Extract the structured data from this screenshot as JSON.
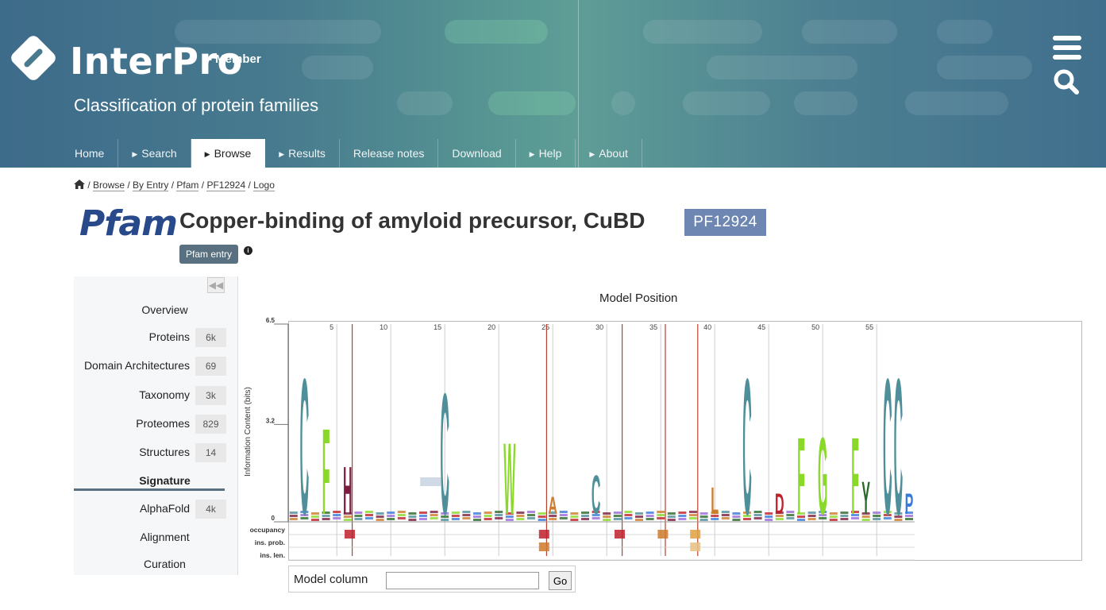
{
  "header": {
    "app_name": "InterPro",
    "app_suffix": "- Member",
    "tagline": "Classification of protein families"
  },
  "nav": [
    {
      "label": "Home",
      "arrow": false
    },
    {
      "label": "Search",
      "arrow": true
    },
    {
      "label": "Browse",
      "arrow": true,
      "active": true
    },
    {
      "label": "Results",
      "arrow": true
    },
    {
      "label": "Release notes",
      "arrow": false
    },
    {
      "label": "Download",
      "arrow": false
    },
    {
      "label": "Help",
      "arrow": true
    },
    {
      "label": "About",
      "arrow": true
    }
  ],
  "breadcrumb": [
    "Browse",
    "By Entry",
    "Pfam",
    "PF12924",
    "Logo"
  ],
  "entry": {
    "db_logo": "Pfam",
    "title": "Copper-binding of amyloid precursor, CuBD",
    "accession": "PF12924",
    "type_badge": "Pfam entry"
  },
  "side_menu": [
    {
      "label": "Overview",
      "count": ""
    },
    {
      "label": "Proteins",
      "count": "6k"
    },
    {
      "label": "Domain Architectures",
      "count": "69"
    },
    {
      "label": "Taxonomy",
      "count": "3k"
    },
    {
      "label": "Proteomes",
      "count": "829"
    },
    {
      "label": "Structures",
      "count": "14"
    },
    {
      "label": "Signature",
      "count": "",
      "active": true
    },
    {
      "label": "AlphaFold",
      "count": "4k"
    },
    {
      "label": "Alignment",
      "count": ""
    },
    {
      "label": "Curation",
      "count": ""
    }
  ],
  "hmm_logo": {
    "title": "Model Position",
    "y_axis_label": "Information Content (bits)",
    "y_ticks": [
      "6.5",
      "3.2",
      "0"
    ],
    "row_labels": [
      "occupancy",
      "ins. prob.",
      "ins. len."
    ],
    "x_ticks": [
      "5",
      "10",
      "15",
      "20",
      "25",
      "30",
      "35",
      "40",
      "45",
      "50",
      "55"
    ],
    "letters": [
      {
        "pos": 2,
        "aa": "C",
        "color": "#4f8f9a",
        "height": 4.6
      },
      {
        "pos": 4,
        "aa": "F",
        "color": "#8ad92a",
        "height": 2.9
      },
      {
        "pos": 6,
        "aa": "H",
        "color": "#7a1d3f",
        "height": 1.6
      },
      {
        "pos": 15,
        "aa": "C",
        "color": "#4f8f9a",
        "height": 4.1
      },
      {
        "pos": 21,
        "aa": "W",
        "color": "#8ad92a",
        "height": 2.4
      },
      {
        "pos": 25,
        "aa": "A",
        "color": "#d07a2b",
        "height": 0.6
      },
      {
        "pos": 29,
        "aa": "C",
        "color": "#4f8f9a",
        "height": 1.3
      },
      {
        "pos": 40,
        "aa": "L",
        "color": "#d07a2b",
        "height": 0.9
      },
      {
        "pos": 43,
        "aa": "C",
        "color": "#4f8f9a",
        "height": 4.6
      },
      {
        "pos": 46,
        "aa": "D",
        "color": "#c0202a",
        "height": 0.7
      },
      {
        "pos": 48,
        "aa": "F",
        "color": "#8ad92a",
        "height": 2.6
      },
      {
        "pos": 50,
        "aa": "G",
        "color": "#8ad92a",
        "height": 2.6
      },
      {
        "pos": 53,
        "aa": "F",
        "color": "#8ad92a",
        "height": 2.6
      },
      {
        "pos": 54,
        "aa": "Y",
        "color": "#2a6a2a",
        "height": 1.1
      },
      {
        "pos": 56,
        "aa": "C",
        "color": "#4f8f9a",
        "height": 4.6
      },
      {
        "pos": 57,
        "aa": "C",
        "color": "#4f8f9a",
        "height": 4.6
      },
      {
        "pos": 58,
        "aa": "P",
        "color": "#3a7ad9",
        "height": 0.7
      }
    ]
  },
  "model_column": {
    "label": "Model column",
    "value": "",
    "button": "Go"
  },
  "colors": {
    "accent": "#6d86b2",
    "badge": "#58707f",
    "pfam_blue": "#28498a",
    "insert_line": "#b7412f"
  }
}
